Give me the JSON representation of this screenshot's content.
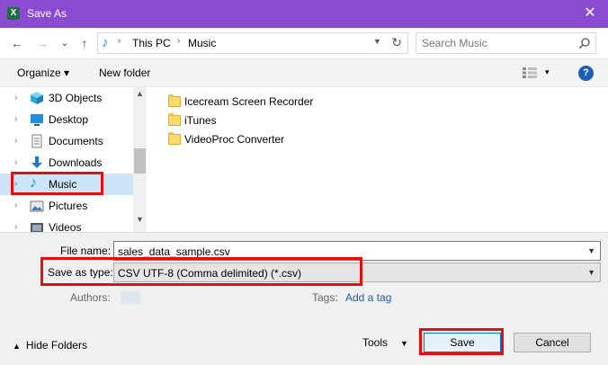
{
  "window": {
    "title": "Save As",
    "app_icon_letter": "X",
    "close_glyph": "✕"
  },
  "toolbar": {
    "back_glyph": "←",
    "forward_glyph": "→",
    "recent_glyph": "⌄",
    "up_glyph": "↑"
  },
  "address": {
    "crumbs": [
      "This PC",
      "Music"
    ],
    "separator": "›",
    "refresh_glyph": "↻"
  },
  "search": {
    "placeholder": "Search Music"
  },
  "commands": {
    "organize_label": "Organize ▾",
    "new_folder_label": "New folder",
    "view_arrow": "▾",
    "help_label": "?"
  },
  "nav": {
    "expand_glyph": "›",
    "items": [
      {
        "label": "3D Objects",
        "icon": "3d-objects-icon"
      },
      {
        "label": "Desktop",
        "icon": "desktop-icon"
      },
      {
        "label": "Documents",
        "icon": "documents-icon"
      },
      {
        "label": "Downloads",
        "icon": "downloads-icon"
      },
      {
        "label": "Music",
        "icon": "music-icon",
        "selected": true
      },
      {
        "label": "Pictures",
        "icon": "pictures-icon"
      },
      {
        "label": "Videos",
        "icon": "videos-icon"
      }
    ]
  },
  "files": {
    "items": [
      {
        "name": "Icecream Screen Recorder",
        "icon": "folder-icon"
      },
      {
        "name": "iTunes",
        "icon": "folder-icon"
      },
      {
        "name": "VideoProc Converter",
        "icon": "folder-icon"
      }
    ]
  },
  "form": {
    "file_name_label": "File name:",
    "file_name_value": "sales_data_sample.csv",
    "save_type_label": "Save as type:",
    "save_type_value": "CSV UTF-8 (Comma delimited) (*.csv)",
    "authors_label": "Authors:",
    "tags_label": "Tags:",
    "tags_value": "Add a tag"
  },
  "footer": {
    "hide_folders_label": "Hide Folders",
    "hide_folders_glyph": "▲",
    "tools_label": "Tools",
    "tools_arrow": "▼",
    "save_label": "Save",
    "cancel_label": "Cancel"
  },
  "colors": {
    "titlebar": "#8a4bd0",
    "highlight": "#e01010",
    "selection": "#cce4f7",
    "link": "#1a5fb4"
  }
}
